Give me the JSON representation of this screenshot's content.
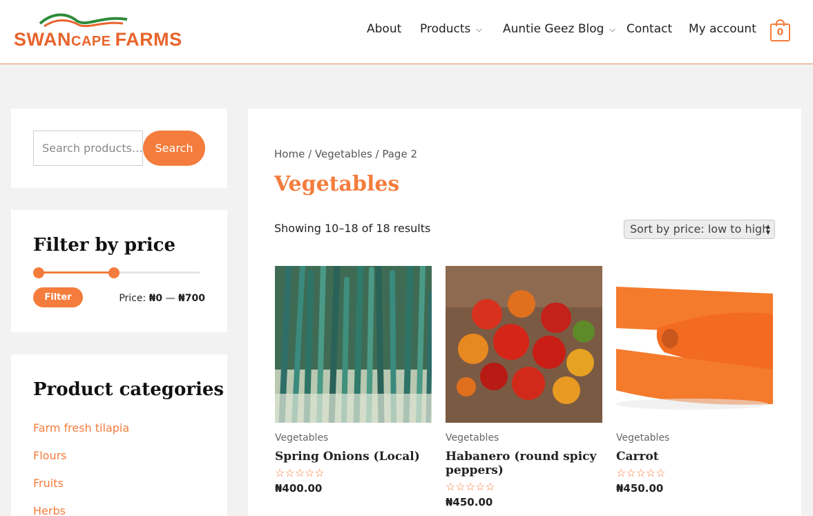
{
  "brand": {
    "logo_text_part1": "SWAN",
    "logo_text_part2": "CAPE",
    "logo_text_part3": "FARMS",
    "colors": {
      "accent": "#f47c3c",
      "logo_green": "#2e8b3a",
      "logo_orange": "#e8642c"
    }
  },
  "nav": {
    "items": [
      {
        "label": "About",
        "has_dropdown": false
      },
      {
        "label": "Products",
        "has_dropdown": true
      },
      {
        "label": "Auntie Geez Blog",
        "has_dropdown": true
      },
      {
        "label": "Contact",
        "has_dropdown": false
      },
      {
        "label": "My account",
        "has_dropdown": false
      }
    ],
    "cart_count": "0"
  },
  "sidebar": {
    "search": {
      "placeholder": "Search products…",
      "button_label": "Search"
    },
    "price_filter": {
      "title": "Filter by price",
      "button_label": "Filter",
      "price_prefix": "Price: ",
      "min": "₦0",
      "separator": " — ",
      "max": "₦700",
      "range_fraction": [
        0,
        0.46
      ]
    },
    "categories": {
      "title": "Product categories",
      "items": [
        "Farm fresh tilapia",
        "Flours",
        "Fruits",
        "Herbs"
      ]
    }
  },
  "main": {
    "breadcrumb": "Home / Vegetables / Page 2",
    "title": "Vegetables",
    "result_count": "Showing 10–18 of 18 results",
    "sort_value": "Sort by price: low to high",
    "products": [
      {
        "category": "Vegetables",
        "name": "Spring Onions (Local)",
        "rating_stars": "☆☆☆☆☆",
        "price": "₦400.00",
        "image_icon": "spring-onions-image"
      },
      {
        "category": "Vegetables",
        "name": "Habanero (round spicy peppers)",
        "rating_stars": "☆☆☆☆☆",
        "price": "₦450.00",
        "image_icon": "habanero-image"
      },
      {
        "category": "Vegetables",
        "name": "Carrot",
        "rating_stars": "☆☆☆☆☆",
        "price": "₦450.00",
        "image_icon": "carrot-image"
      }
    ]
  }
}
